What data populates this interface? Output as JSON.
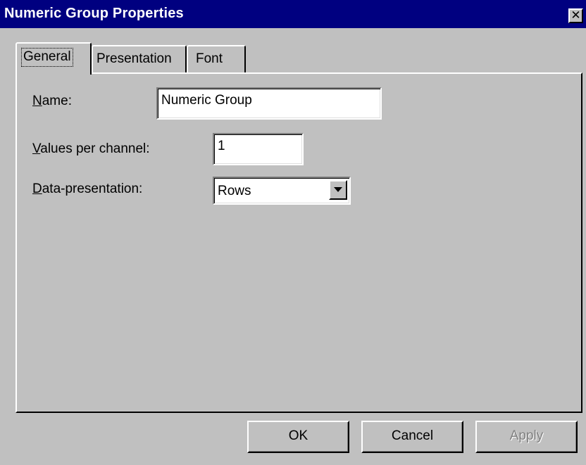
{
  "window": {
    "title": "Numeric Group Properties",
    "close_glyph": "✕"
  },
  "tabs": [
    {
      "label": "General",
      "selected": true
    },
    {
      "label": "Presentation",
      "selected": false
    },
    {
      "label": "Font",
      "selected": false
    }
  ],
  "general": {
    "name_label_mnemonic": "N",
    "name_label_rest": "ame:",
    "name_value": "Numeric Group",
    "values_label_mnemonic": "V",
    "values_label_rest": "alues per channel:",
    "values_value": "1",
    "presentation_label_mnemonic": "D",
    "presentation_label_rest": "ata-presentation:",
    "presentation_value": "Rows"
  },
  "buttons": {
    "ok": "OK",
    "cancel": "Cancel",
    "apply": "Apply"
  },
  "colors": {
    "titlebar": "#000080",
    "face": "#c0c0c0"
  },
  "icons": {
    "close": "close-icon",
    "dropdown": "chevron-down-icon"
  }
}
